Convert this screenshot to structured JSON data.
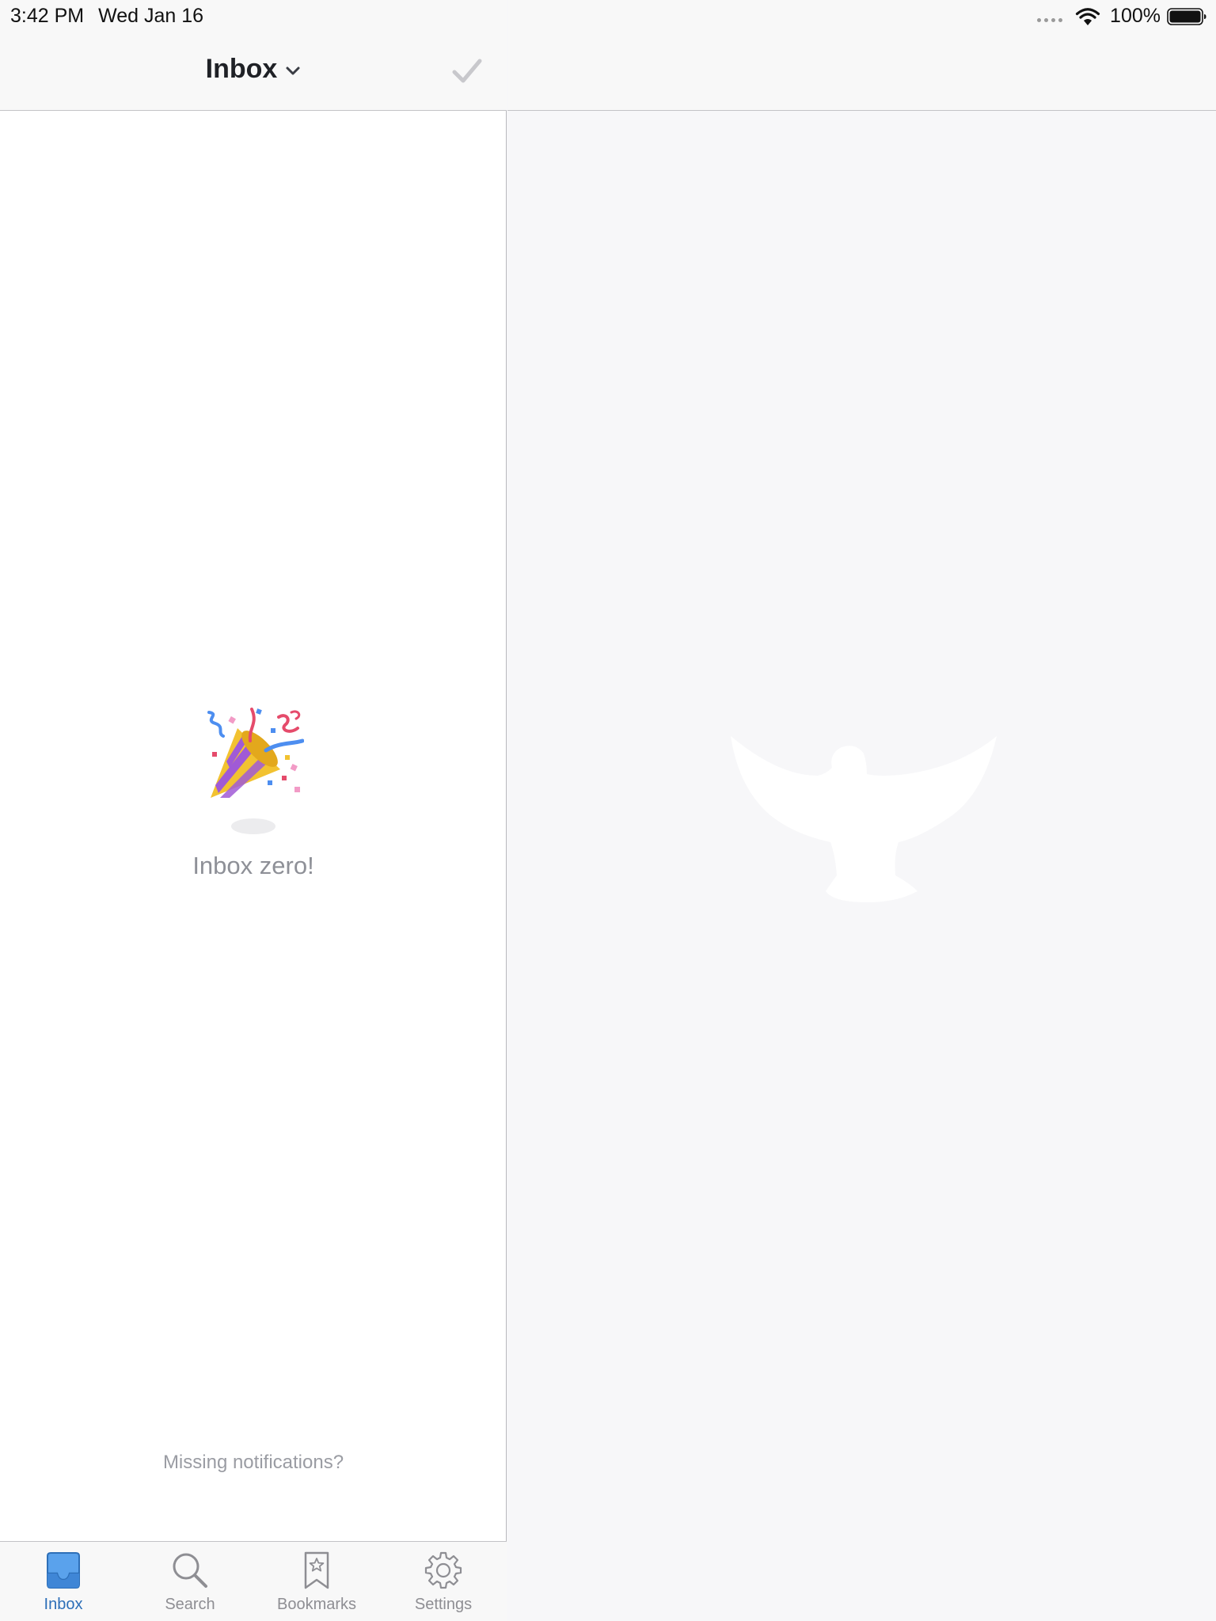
{
  "status_bar": {
    "time": "3:42 PM",
    "date": "Wed Jan 16",
    "battery": "100%"
  },
  "nav": {
    "title": "Inbox",
    "title_icon": "chevron-down-icon",
    "action_icon": "checkmark-icon"
  },
  "empty_state": {
    "icon": "party-popper-icon",
    "text": "Inbox zero!"
  },
  "footer_link": "Missing notifications?",
  "tabs": [
    {
      "label": "Inbox",
      "icon": "inbox-tray-icon",
      "active": true
    },
    {
      "label": "Search",
      "icon": "search-icon",
      "active": false
    },
    {
      "label": "Bookmarks",
      "icon": "bookmark-icon",
      "active": false
    },
    {
      "label": "Settings",
      "icon": "gear-icon",
      "active": false
    }
  ],
  "colors": {
    "accent": "#2d6fb8",
    "inactive": "#8e8e93",
    "muted_text": "#8e9097"
  },
  "detail_placeholder_icon": "bird-logo-icon"
}
